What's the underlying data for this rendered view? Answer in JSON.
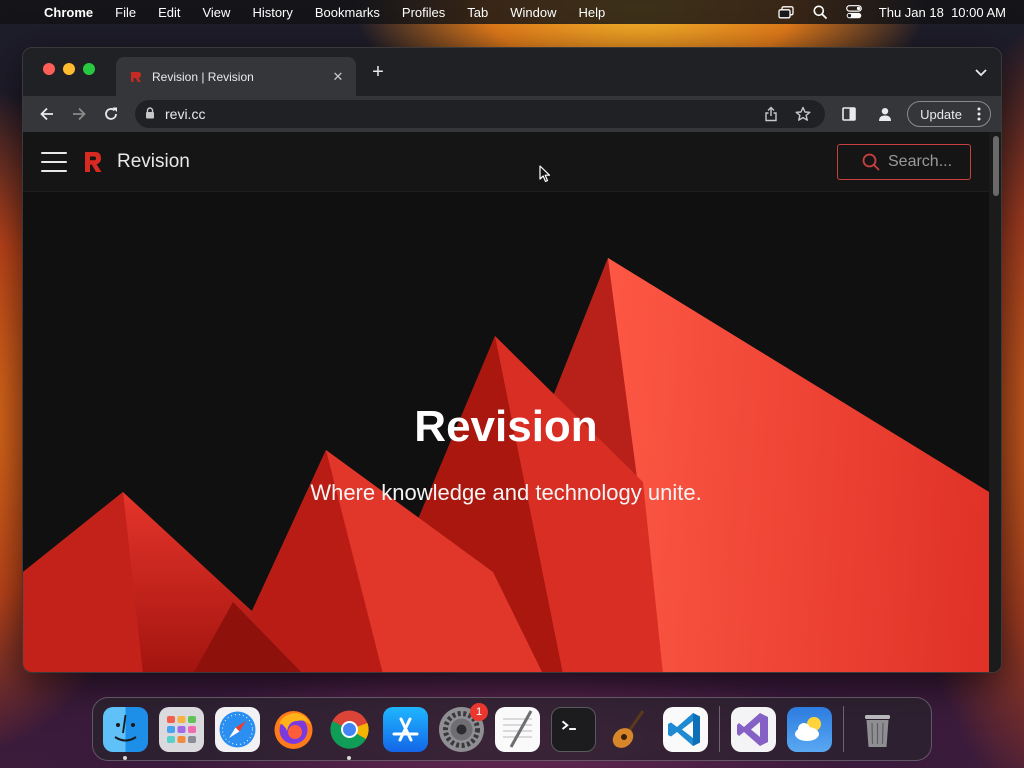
{
  "menubar": {
    "app_name": "Chrome",
    "items": [
      "File",
      "Edit",
      "View",
      "History",
      "Bookmarks",
      "Profiles",
      "Tab",
      "Window",
      "Help"
    ],
    "clock": "Thu Jan 18  10:00 AM"
  },
  "browser": {
    "tab_title": "Revision | Revision",
    "tab_close": "✕",
    "new_tab": "+",
    "url": "revi.cc",
    "update_label": "Update"
  },
  "site": {
    "name": "Revision",
    "search_placeholder": "Search...",
    "hero_title": "Revision",
    "hero_subtitle": "Where knowledge and technology unite."
  },
  "dock": {
    "apps": [
      "Finder",
      "Launchpad",
      "Safari",
      "Firefox",
      "Chrome",
      "App Store",
      "System Settings",
      "TextEdit",
      "Terminal",
      "GarageBand",
      "Visual Studio Code",
      "Visual Studio",
      "Weather",
      "Trash"
    ],
    "settings_badge": "1"
  },
  "colors": {
    "accent_red": "#e8332b",
    "page_bg": "#101010",
    "header_bg": "#151515"
  }
}
